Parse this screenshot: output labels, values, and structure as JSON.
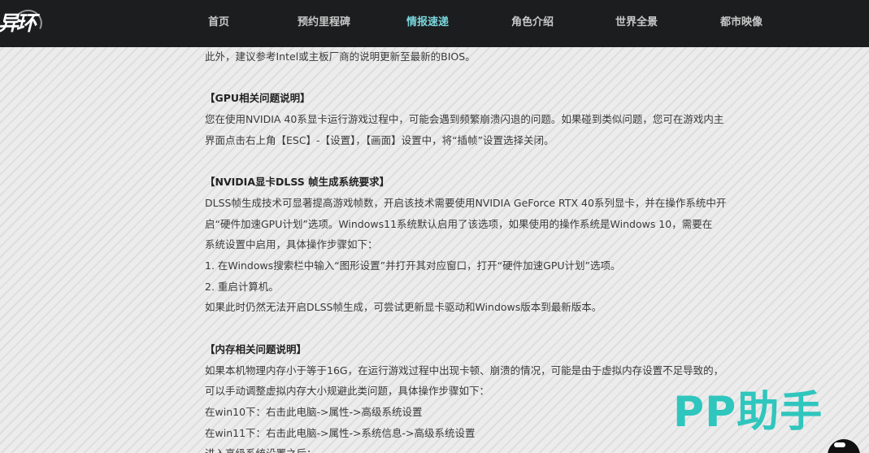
{
  "header": {
    "logo_text": "异环",
    "nav": [
      {
        "label": "首页",
        "active": false
      },
      {
        "label": "预约里程碑",
        "active": false
      },
      {
        "label": "情报速递",
        "active": true
      },
      {
        "label": "角色介绍",
        "active": false
      },
      {
        "label": "世界全景",
        "active": false
      },
      {
        "label": "都市映像",
        "active": false
      }
    ]
  },
  "article": {
    "intro": "此外，建议参考Intel或主板厂商的说明更新至最新的BIOS。",
    "gpu": {
      "title": "【GPU相关问题说明】",
      "lines": [
        "您在使用NVIDIA 40系显卡运行游戏过程中，可能会遇到频繁崩溃闪退的问题。如果碰到类似问题，您可在游戏内主",
        "界面点击右上角【ESC】-【设置】，【画面】设置中，将“插帧”设置选择关闭。"
      ]
    },
    "dlss": {
      "title": "【NVIDIA显卡DLSS 帧生成系统要求】",
      "lines": [
        "DLSS帧生成技术可显著提高游戏帧数，开启该技术需要使用NVIDIA GeForce RTX 40系列显卡，并在操作系统中开",
        "启“硬件加速GPU计划”选项。Windows11系统默认启用了该选项，如果使用的操作系统是Windows 10，需要在",
        "系统设置中启用，具体操作步骤如下：",
        "1. 在Windows搜索栏中输入“图形设置”并打开其对应窗口，打开“硬件加速GPU计划”选项。",
        "2. 重启计算机。",
        "如果此时仍然无法开启DLSS帧生成，可尝试更新显卡驱动和Windows版本到最新版本。"
      ]
    },
    "memory": {
      "title": "【内存相关问题说明】",
      "lines": [
        "如果本机物理内存小于等于16G，在运行游戏过程中出现卡顿、崩溃的情况，可能是由于虚拟内存设置不足导致的，",
        "可以手动调整虚拟内存大小规避此类问题，具体操作步骤如下：",
        "在win10下：右击此电脑->属性->高级系统设置",
        "在win11下：右击此电脑->属性->系统信息->高级系统设置",
        "进入高级系统设置之后："
      ]
    }
  },
  "watermark": {
    "text": "PP助手",
    "color": "#2fc6bd"
  },
  "colors": {
    "header_bg": "#1c1d1f",
    "nav_active": "#7ad6dc",
    "nav_inactive": "#c9c9c9",
    "body_text": "#3a3a3a"
  }
}
